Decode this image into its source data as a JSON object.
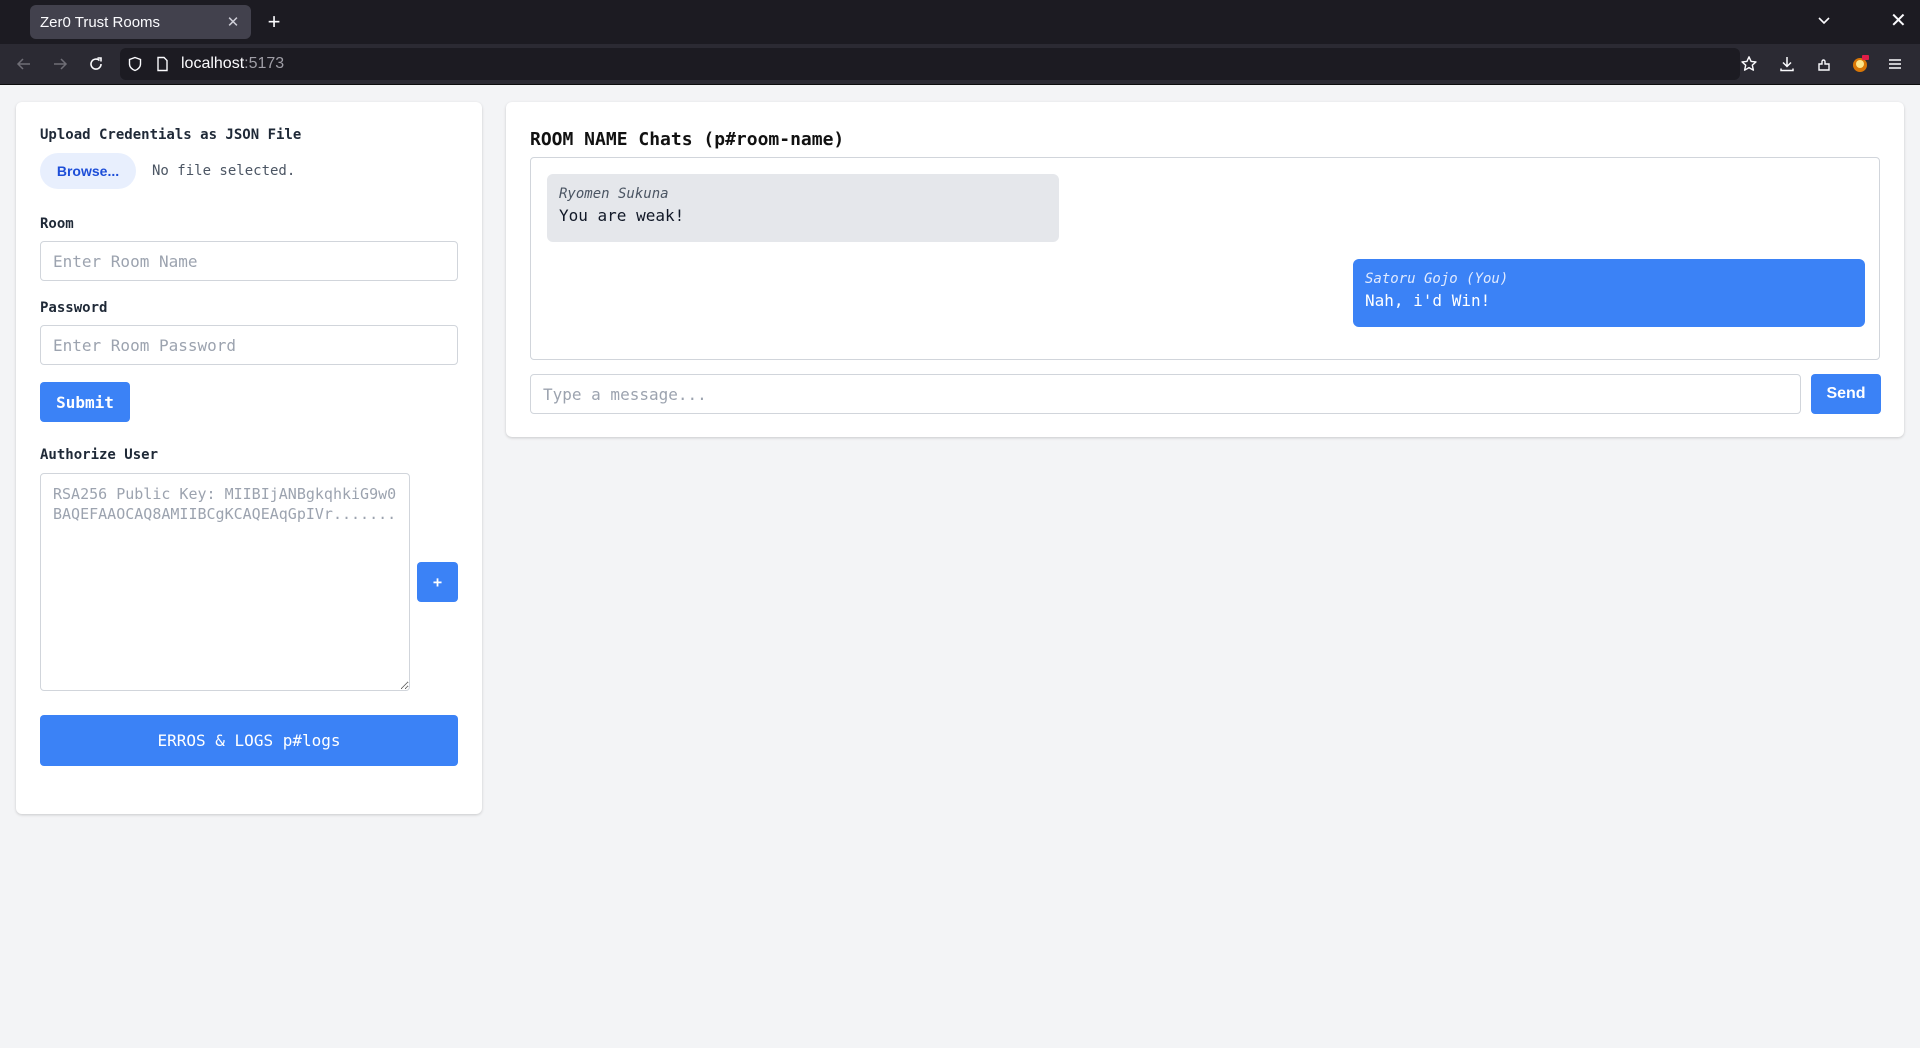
{
  "browser": {
    "tab_title": "Zer0 Trust Rooms",
    "url_host": "localhost",
    "url_port": ":5173",
    "icons": [
      "back-icon",
      "forward-icon",
      "reload-icon",
      "shield-icon",
      "page-icon",
      "star-icon",
      "download-icon",
      "extensions-icon",
      "profile-icon",
      "menu-icon",
      "new-tab-icon",
      "tab-close-icon",
      "tab-list-icon",
      "window-close-icon"
    ]
  },
  "left": {
    "upload_label": "Upload Credentials as JSON File",
    "browse_label": "Browse...",
    "file_status": "No file selected.",
    "room_label": "Room",
    "room_placeholder": "Enter Room Name",
    "password_label": "Password",
    "password_placeholder": "Enter Room Password",
    "submit_label": "Submit",
    "authorize_label": "Authorize User",
    "key_placeholder": "RSA256 Public Key: MIIBIjANBgkqhkiG9w0BAQEFAAOCAQ8AMIIBCgKCAQEAqGpIVr.......",
    "add_label": "+",
    "logs_label": "ERROS & LOGS p#logs"
  },
  "chat": {
    "title": "ROOM NAME Chats (p#room-name)",
    "messages": [
      {
        "sender": "Ryomen Sukuna",
        "text": "You are weak!",
        "mine": false
      },
      {
        "sender": "Satoru Gojo (You)",
        "text": "Nah, i'd Win!",
        "mine": true
      }
    ],
    "input_placeholder": "Type a message...",
    "send_label": "Send"
  },
  "colors": {
    "accent": "#3b82f6",
    "page_bg": "#f3f4f6",
    "other_bubble": "#e5e7eb"
  }
}
